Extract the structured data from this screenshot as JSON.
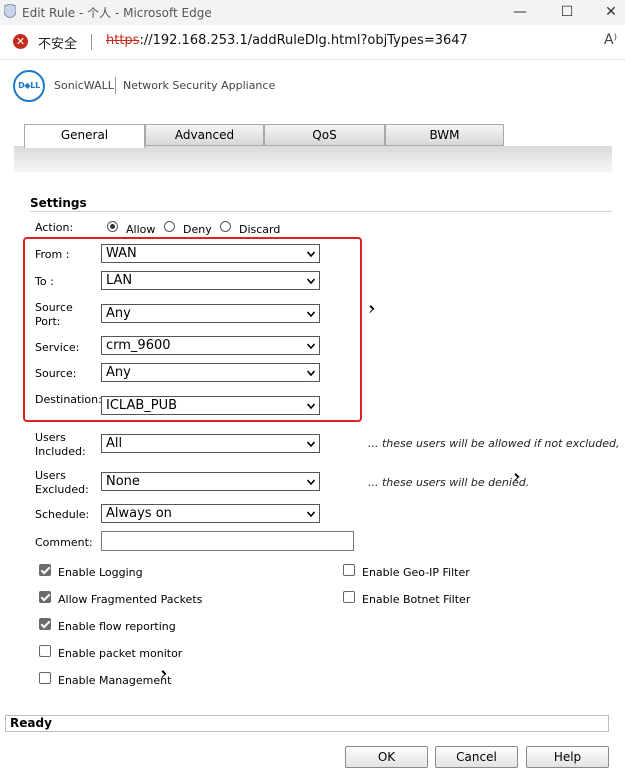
{
  "window": {
    "title": "Edit Rule - 个人 - Microsoft Edge",
    "minimize_glyph": "—",
    "maximize_glyph": "☐",
    "close_glyph": "✕"
  },
  "addressbar": {
    "security_label": "不安全",
    "url_scheme": "https",
    "url_rest": "://192.168.253.1/addRuleDlg.html?objTypes=3647",
    "read_aloud_glyph": "A⁾",
    "insecure_icon_glyph": "✕"
  },
  "header": {
    "logo_text": "D◆LL",
    "product": "SonicWALL",
    "subtitle": "Network Security Appliance"
  },
  "tabs": [
    {
      "label": "General",
      "active": true
    },
    {
      "label": "Advanced",
      "active": false
    },
    {
      "label": "QoS",
      "active": false
    },
    {
      "label": "BWM",
      "active": false
    }
  ],
  "settings": {
    "section_title": "Settings",
    "action_label": "Action:",
    "actions": [
      "Allow",
      "Deny",
      "Discard"
    ],
    "action_selected": "Allow",
    "from_label": "From :",
    "from_value": "WAN",
    "to_label": "To :",
    "to_value": "LAN",
    "source_port_label_1": "Source",
    "source_port_label_2": "Port:",
    "source_port_value": "Any",
    "service_label": "Service:",
    "service_value": "crm_9600",
    "source_label": "Source:",
    "source_value": "Any",
    "destination_label": "Destination:",
    "destination_value": "ICLAB_PUB",
    "users_included_label_1": "Users",
    "users_included_label_2": "Included:",
    "users_included_value": "All",
    "users_included_hint": "... these users will be allowed if not excluded,",
    "users_excluded_label_1": "Users",
    "users_excluded_label_2": "Excluded:",
    "users_excluded_value": "None",
    "users_excluded_hint": "... these users will be denied.",
    "schedule_label": "Schedule:",
    "schedule_value": "Always on",
    "comment_label": "Comment:",
    "comment_value": ""
  },
  "options": [
    {
      "label": "Enable Logging",
      "checked": true
    },
    {
      "label": "Allow Fragmented Packets",
      "checked": true
    },
    {
      "label": "Enable flow reporting",
      "checked": true
    },
    {
      "label": "Enable packet monitor",
      "checked": false
    },
    {
      "label": "Enable Management",
      "checked": false
    }
  ],
  "options_right": [
    {
      "label": "Enable Geo-IP Filter",
      "checked": false
    },
    {
      "label": "Enable Botnet Filter",
      "checked": false
    }
  ],
  "status": {
    "text": "Ready"
  },
  "buttons": {
    "ok": "OK",
    "cancel": "Cancel",
    "help": "Help"
  }
}
